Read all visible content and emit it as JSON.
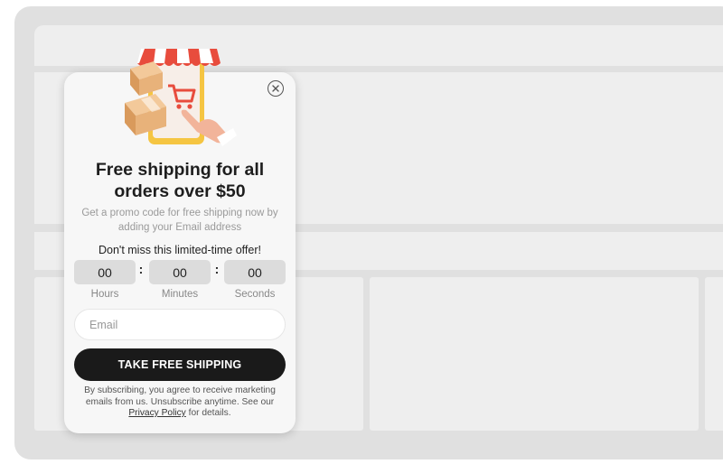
{
  "popup": {
    "title_line1": "Free shipping for all",
    "title_line2": "orders over $50",
    "subtitle_line1": "Get a promo code for free shipping now by",
    "subtitle_line2": "adding your Email address",
    "offer_text": "Don't miss this limited-time offer!",
    "timer": {
      "hours": "00",
      "minutes": "00",
      "seconds": "00",
      "separator": ":",
      "hours_label": "Hours",
      "minutes_label": "Minutes",
      "seconds_label": "Seconds"
    },
    "email": {
      "placeholder": "Email",
      "value": ""
    },
    "cta_label": "TAKE FREE SHIPPING",
    "disclaimer": {
      "line1": "By subscribing, you agree to receive marketing",
      "line2": "emails from us. Unsubscribe anytime. See our",
      "privacy_link": "Privacy Policy",
      "suffix": " for details."
    },
    "icons": {
      "close": "close-icon",
      "illustration": "shop-illustration"
    }
  },
  "colors": {
    "cta_background": "#1a1a1a",
    "awning_red": "#e84c3d",
    "popup_background": "#f7f7f7"
  }
}
